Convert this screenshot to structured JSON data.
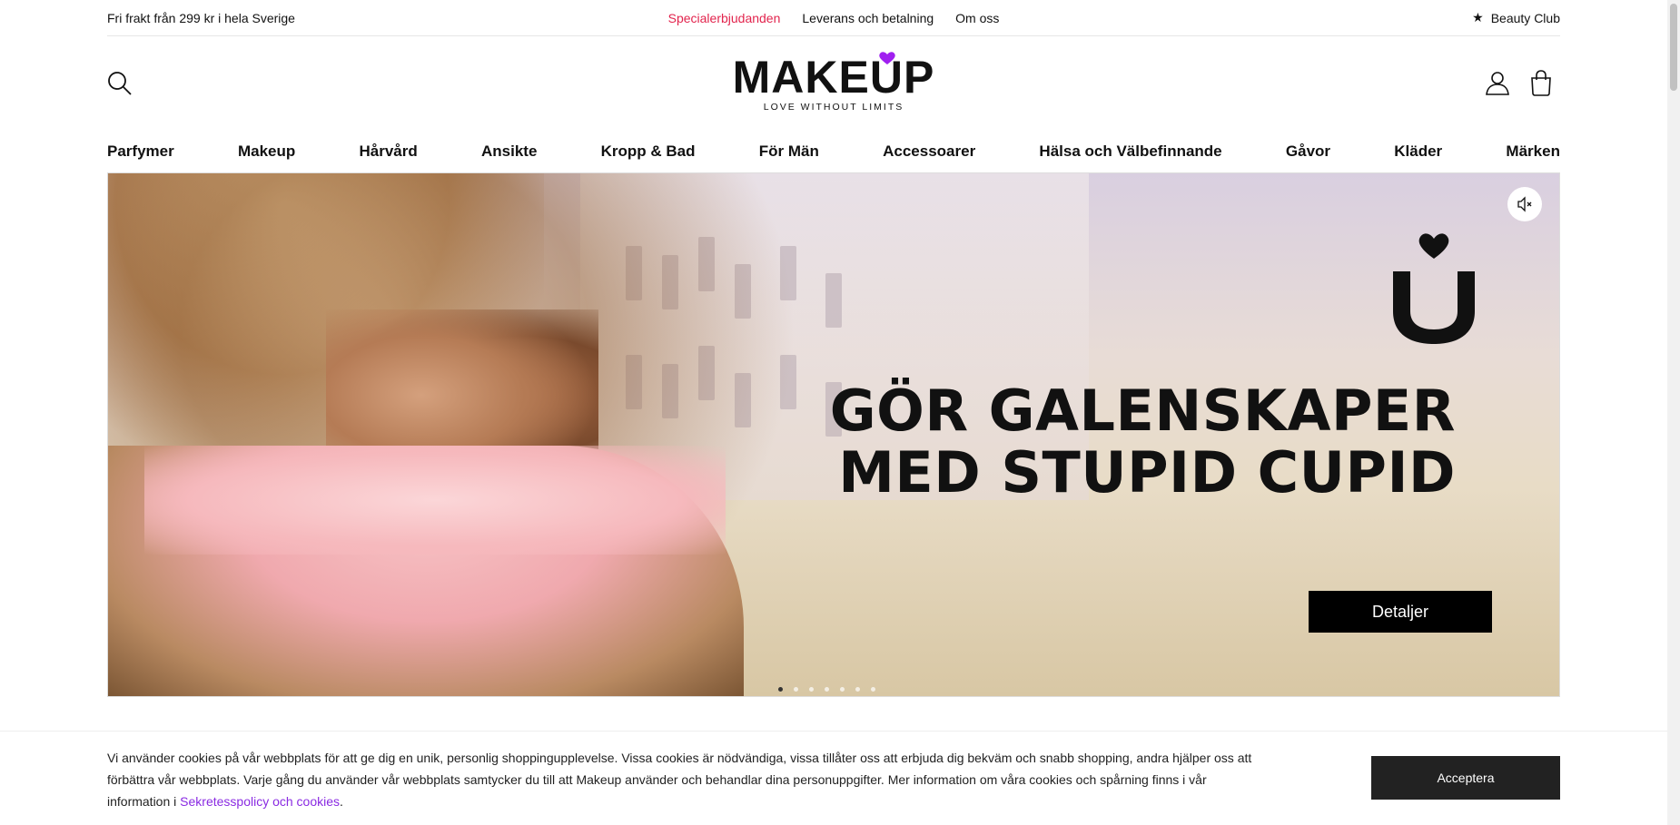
{
  "topbar": {
    "shipping_text": "Fri frakt från 299 kr i hela Sverige",
    "links": [
      "Specialerbjudanden",
      "Leverans och betalning",
      "Om oss"
    ],
    "club_label": "Beauty Club"
  },
  "header": {
    "logo_word": "MAKEUP",
    "logo_tagline": "LOVE WITHOUT LIMITS",
    "icons": [
      "search-icon",
      "account-icon",
      "bag-icon"
    ]
  },
  "nav": {
    "items": [
      "Parfymer",
      "Makeup",
      "Hårvård",
      "Ansikte",
      "Kropp & Bad",
      "För Män",
      "Accessoarer",
      "Hälsa och Välbefinnande",
      "Gåvor",
      "Kläder",
      "Märken"
    ]
  },
  "hero": {
    "headline_line1": "GÖR GALENSKAPER",
    "headline_line2": "MED STUPID CUPID",
    "button_label": "Detaljer",
    "slide_count": 7,
    "active_slide": 1
  },
  "cookie": {
    "text": "Vi använder cookies på vår webbplats för att ge dig en unik, personlig shoppingupplevelse. Vissa cookies är nödvändiga, vissa tillåter oss att erbjuda dig bekväm och snabb shopping, andra hjälper oss att förbättra vår webbplats. Varje gång du använder vår webbplats samtycker du till att Makeup använder och behandlar dina personuppgifter. Mer information om våra cookies och spårning finns i vår information i ",
    "link_text": "Sekretesspolicy och cookies",
    "after_link": ".",
    "accept_label": "Acceptera"
  },
  "colors": {
    "promo": "#e2244d",
    "brand_heart": "#a020f0",
    "link": "#8a2be2",
    "button_dark": "#222222"
  }
}
